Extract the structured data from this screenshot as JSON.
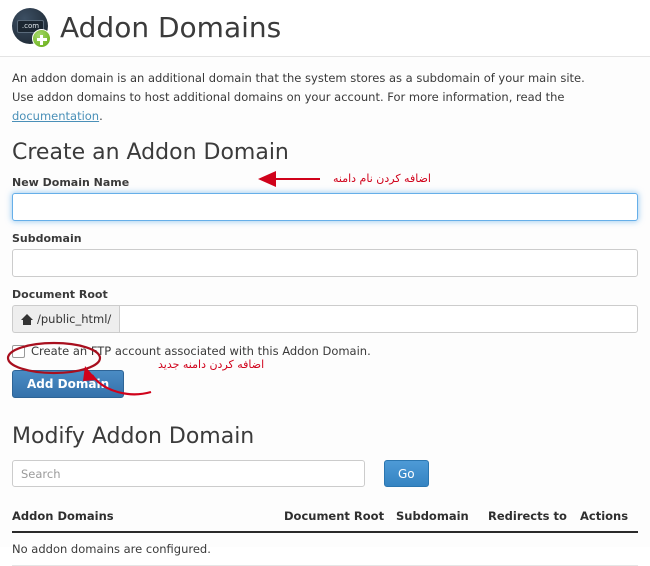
{
  "header": {
    "title": "Addon Domains",
    "icon_name": "dot-com-add-icon",
    "icon_label": ".com"
  },
  "intro": {
    "line1": "An addon domain is an additional domain that the system stores as a subdomain of your main site.",
    "line2_before": "Use addon domains to host additional domains on your account. For more information, read the ",
    "link_text": "documentation",
    "line2_after": "."
  },
  "create_section": {
    "title": "Create an Addon Domain",
    "new_domain": {
      "label": "New Domain Name",
      "value": "",
      "placeholder": ""
    },
    "subdomain": {
      "label": "Subdomain",
      "value": "",
      "placeholder": ""
    },
    "document_root": {
      "label": "Document Root",
      "addon_icon": "home-icon",
      "addon_text": "/public_html/",
      "value": "",
      "placeholder": ""
    },
    "ftp_checkbox": {
      "label": "Create an FTP account associated with this Addon Domain.",
      "checked": false
    },
    "add_button": "Add Domain"
  },
  "modify_section": {
    "title": "Modify Addon Domain",
    "search": {
      "value": "",
      "placeholder": "Search"
    },
    "go_button": "Go",
    "table": {
      "columns": [
        "Addon Domains",
        "Document Root",
        "Subdomain",
        "Redirects to",
        "Actions"
      ],
      "rows": [],
      "empty_message": "No addon domains are configured."
    }
  },
  "annotations": {
    "domain_name_note": "اضافه کردن نام دامنه",
    "add_domain_note": "اضافه کردن دامنه جدید",
    "accent_color": "#d0021b"
  },
  "colors": {
    "primary_button": "#3a7ab5",
    "go_button": "#3c8dcc",
    "link": "#4a90b8",
    "focus_border": "#66afe9",
    "annotation": "#d0021b"
  }
}
